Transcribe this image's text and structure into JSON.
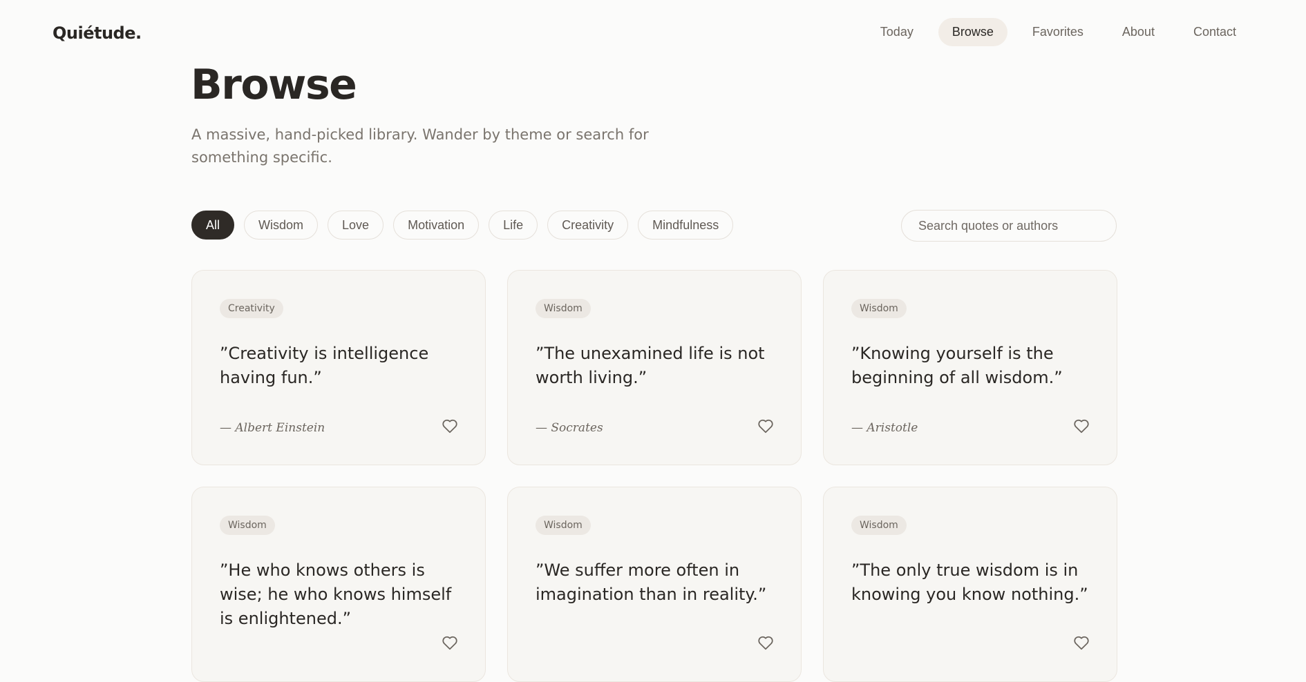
{
  "brand": {
    "logo": "Quiétude."
  },
  "nav": [
    {
      "label": "Today",
      "active": false
    },
    {
      "label": "Browse",
      "active": true
    },
    {
      "label": "Favorites",
      "active": false
    },
    {
      "label": "About",
      "active": false
    },
    {
      "label": "Contact",
      "active": false
    }
  ],
  "page": {
    "title": "Browse",
    "subtitle": "A massive, hand-picked library. Wander by theme or search for something specific."
  },
  "filters": {
    "chips": [
      {
        "label": "All",
        "active": true
      },
      {
        "label": "Wisdom",
        "active": false
      },
      {
        "label": "Love",
        "active": false
      },
      {
        "label": "Motivation",
        "active": false
      },
      {
        "label": "Life",
        "active": false
      },
      {
        "label": "Creativity",
        "active": false
      },
      {
        "label": "Mindfulness",
        "active": false
      }
    ]
  },
  "search": {
    "placeholder": "Search quotes or authors",
    "value": ""
  },
  "quotes": [
    {
      "tag": "Creativity",
      "text": "”Creativity is intelligence having fun.”",
      "author": "— Albert Einstein",
      "icon": "heart-outline-icon"
    },
    {
      "tag": "Wisdom",
      "text": "”The unexamined life is not worth living.”",
      "author": "— Socrates",
      "icon": "heart-outline-icon"
    },
    {
      "tag": "Wisdom",
      "text": "”Knowing yourself is the beginning of all wisdom.”",
      "author": "— Aristotle",
      "icon": "heart-outline-icon"
    },
    {
      "tag": "Wisdom",
      "text": "”He who knows others is wise; he who knows himself is enlightened.”",
      "author": "",
      "icon": "heart-outline-icon"
    },
    {
      "tag": "Wisdom",
      "text": "”We suffer more often in imagination than in reality.”",
      "author": "",
      "icon": "heart-outline-icon"
    },
    {
      "tag": "Wisdom",
      "text": "”The only true wisdom is in knowing you know nothing.”",
      "author": "",
      "icon": "heart-outline-icon"
    }
  ],
  "colors": {
    "background": "#fbfbfa",
    "text": "#2a2724",
    "muted": "#7a746d",
    "active_chip": "#2f2b27",
    "nav_active_bg": "#f2ede7",
    "card_bg": "#f7f6f3",
    "card_border": "#ebe6df"
  }
}
